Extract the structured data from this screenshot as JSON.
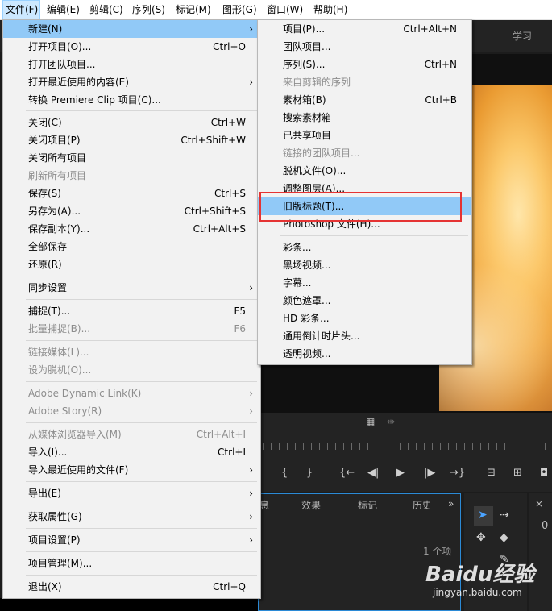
{
  "menubar": {
    "items": [
      "文件(F)",
      "编辑(E)",
      "剪辑(C)",
      "序列(S)",
      "标记(M)",
      "图形(G)",
      "窗口(W)",
      "帮助(H)"
    ]
  },
  "workspace": {
    "learn_label": "学习"
  },
  "file_menu": [
    {
      "label": "新建(N)",
      "shortcut": "",
      "submenu": true,
      "disabled": false,
      "highlighted": true
    },
    {
      "label": "打开项目(O)...",
      "shortcut": "Ctrl+O",
      "submenu": false,
      "disabled": false
    },
    {
      "label": "打开团队项目...",
      "shortcut": "",
      "submenu": false,
      "disabled": false
    },
    {
      "label": "打开最近使用的内容(E)",
      "shortcut": "",
      "submenu": true,
      "disabled": false
    },
    {
      "label": "转换 Premiere Clip 项目(C)...",
      "shortcut": "",
      "submenu": false,
      "disabled": false
    },
    {
      "label": "关闭(C)",
      "shortcut": "Ctrl+W",
      "submenu": false,
      "disabled": false
    },
    {
      "label": "关闭项目(P)",
      "shortcut": "Ctrl+Shift+W",
      "submenu": false,
      "disabled": false
    },
    {
      "label": "关闭所有项目",
      "shortcut": "",
      "submenu": false,
      "disabled": false
    },
    {
      "label": "刷新所有项目",
      "shortcut": "",
      "submenu": false,
      "disabled": true
    },
    {
      "label": "保存(S)",
      "shortcut": "Ctrl+S",
      "submenu": false,
      "disabled": false
    },
    {
      "label": "另存为(A)...",
      "shortcut": "Ctrl+Shift+S",
      "submenu": false,
      "disabled": false
    },
    {
      "label": "保存副本(Y)...",
      "shortcut": "Ctrl+Alt+S",
      "submenu": false,
      "disabled": false
    },
    {
      "label": "全部保存",
      "shortcut": "",
      "submenu": false,
      "disabled": false
    },
    {
      "label": "还原(R)",
      "shortcut": "",
      "submenu": false,
      "disabled": false
    },
    {
      "label": "同步设置",
      "shortcut": "",
      "submenu": true,
      "disabled": false
    },
    {
      "label": "捕捉(T)...",
      "shortcut": "F5",
      "submenu": false,
      "disabled": false
    },
    {
      "label": "批量捕捉(B)...",
      "shortcut": "F6",
      "submenu": false,
      "disabled": true
    },
    {
      "label": "链接媒体(L)...",
      "shortcut": "",
      "submenu": false,
      "disabled": true
    },
    {
      "label": "设为脱机(O)...",
      "shortcut": "",
      "submenu": false,
      "disabled": true
    },
    {
      "label": "Adobe Dynamic Link(K)",
      "shortcut": "",
      "submenu": true,
      "disabled": true
    },
    {
      "label": "Adobe Story(R)",
      "shortcut": "",
      "submenu": true,
      "disabled": true
    },
    {
      "label": "从媒体浏览器导入(M)",
      "shortcut": "Ctrl+Alt+I",
      "submenu": false,
      "disabled": true
    },
    {
      "label": "导入(I)...",
      "shortcut": "Ctrl+I",
      "submenu": false,
      "disabled": false
    },
    {
      "label": "导入最近使用的文件(F)",
      "shortcut": "",
      "submenu": true,
      "disabled": false
    },
    {
      "label": "导出(E)",
      "shortcut": "",
      "submenu": true,
      "disabled": false
    },
    {
      "label": "获取属性(G)",
      "shortcut": "",
      "submenu": true,
      "disabled": false
    },
    {
      "label": "项目设置(P)",
      "shortcut": "",
      "submenu": true,
      "disabled": false
    },
    {
      "label": "项目管理(M)...",
      "shortcut": "",
      "submenu": false,
      "disabled": false
    },
    {
      "label": "退出(X)",
      "shortcut": "Ctrl+Q",
      "submenu": false,
      "disabled": false
    }
  ],
  "new_menu": [
    {
      "label": "项目(P)...",
      "shortcut": "Ctrl+Alt+N",
      "disabled": false
    },
    {
      "label": "团队项目...",
      "shortcut": "",
      "disabled": false
    },
    {
      "label": "序列(S)...",
      "shortcut": "Ctrl+N",
      "disabled": false
    },
    {
      "label": "来自剪辑的序列",
      "shortcut": "",
      "disabled": true
    },
    {
      "label": "素材箱(B)",
      "shortcut": "Ctrl+B",
      "disabled": false
    },
    {
      "label": "搜索素材箱",
      "shortcut": "",
      "disabled": false
    },
    {
      "label": "已共享项目",
      "shortcut": "",
      "disabled": false
    },
    {
      "label": "链接的团队项目...",
      "shortcut": "",
      "disabled": true
    },
    {
      "label": "脱机文件(O)...",
      "shortcut": "",
      "disabled": false
    },
    {
      "label": "调整图层(A)...",
      "shortcut": "",
      "disabled": false
    },
    {
      "label": "旧版标题(T)...",
      "shortcut": "",
      "disabled": false,
      "highlighted": true
    },
    {
      "label": "Photoshop 文件(H)...",
      "shortcut": "",
      "disabled": false
    },
    {
      "label": "彩条...",
      "shortcut": "",
      "disabled": false
    },
    {
      "label": "黑场视频...",
      "shortcut": "",
      "disabled": false
    },
    {
      "label": "字幕...",
      "shortcut": "",
      "disabled": false
    },
    {
      "label": "颜色遮罩...",
      "shortcut": "",
      "disabled": false
    },
    {
      "label": "HD 彩条...",
      "shortcut": "",
      "disabled": false
    },
    {
      "label": "通用倒计时片头...",
      "shortcut": "",
      "disabled": false
    },
    {
      "label": "透明视频...",
      "shortcut": "",
      "disabled": false
    }
  ],
  "panel_tabs": [
    "息",
    "效果",
    "标记",
    "历史"
  ],
  "project_panel": {
    "item_count": "1 个项"
  },
  "watermark": {
    "brand": "Baidu经验",
    "url": "jingyan.baidu.com"
  },
  "icons": {
    "submenu_arrow": "chevron-right-icon",
    "expand": "double-chevron-icon",
    "selection_tool": "arrow-cursor-icon"
  },
  "colors": {
    "menu_bg": "#f2f2f2",
    "highlight": "#91c9f7",
    "disabled_text": "#8d8d8d",
    "annotation_box": "#e53333",
    "panel_focus_border": "#2b8ad6"
  }
}
